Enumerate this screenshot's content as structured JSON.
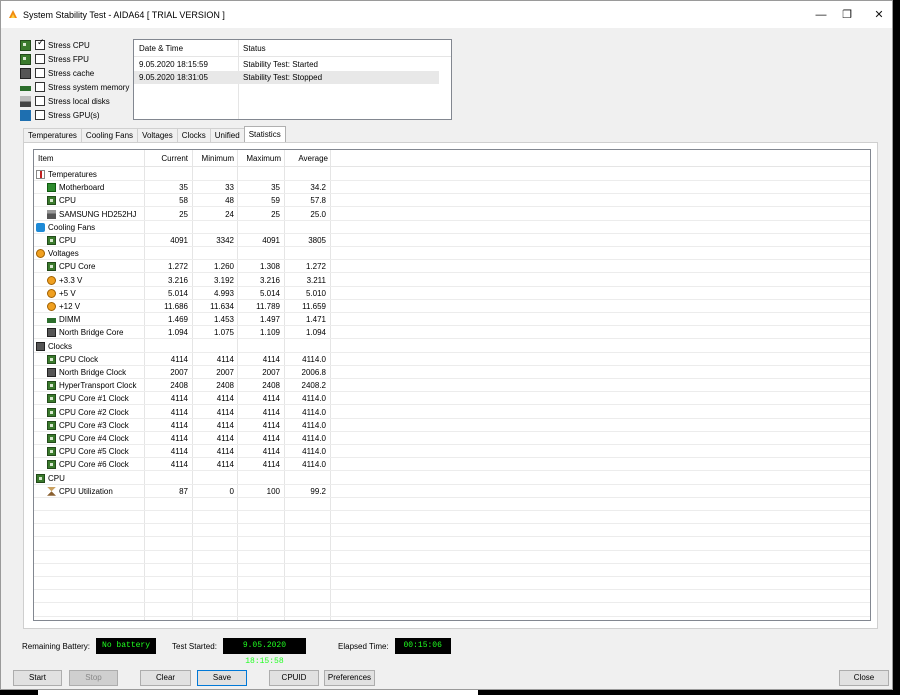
{
  "window": {
    "title": "System Stability Test - AIDA64  [ TRIAL VERSION ]",
    "minimize_glyph": "—",
    "maximize_glyph": "❐",
    "close_glyph": "✕"
  },
  "stress_options": [
    {
      "label": "Stress CPU",
      "checked": true,
      "icon": "cpu-icon"
    },
    {
      "label": "Stress FPU",
      "checked": false,
      "icon": "fpu-icon"
    },
    {
      "label": "Stress cache",
      "checked": false,
      "icon": "cache-icon"
    },
    {
      "label": "Stress system memory",
      "checked": false,
      "icon": "memory-icon"
    },
    {
      "label": "Stress local disks",
      "checked": false,
      "icon": "disk-icon"
    },
    {
      "label": "Stress GPU(s)",
      "checked": false,
      "icon": "gpu-icon"
    }
  ],
  "log": {
    "headers": {
      "datetime": "Date & Time",
      "status": "Status"
    },
    "rows": [
      {
        "datetime": "9.05.2020 18:15:59",
        "status": "Stability Test: Started"
      },
      {
        "datetime": "9.05.2020 18:31:05",
        "status": "Stability Test: Stopped"
      }
    ]
  },
  "tabs": [
    "Temperatures",
    "Cooling Fans",
    "Voltages",
    "Clocks",
    "Unified",
    "Statistics"
  ],
  "active_tab": "Statistics",
  "stats": {
    "headers": {
      "item": "Item",
      "current": "Current",
      "minimum": "Minimum",
      "maximum": "Maximum",
      "average": "Average"
    },
    "rows": [
      {
        "kind": "group",
        "item": "Temperatures",
        "icon": "thermometer-icon"
      },
      {
        "kind": "row",
        "item": "Motherboard",
        "icon": "motherboard-icon",
        "current": "35",
        "minimum": "33",
        "maximum": "35",
        "average": "34.2"
      },
      {
        "kind": "row",
        "item": "CPU",
        "icon": "cpu-icon",
        "current": "58",
        "minimum": "48",
        "maximum": "59",
        "average": "57.8"
      },
      {
        "kind": "row",
        "item": "SAMSUNG HD252HJ",
        "icon": "hdd-icon",
        "current": "25",
        "minimum": "24",
        "maximum": "25",
        "average": "25.0"
      },
      {
        "kind": "group",
        "item": "Cooling Fans",
        "icon": "fan-icon"
      },
      {
        "kind": "row",
        "item": "CPU",
        "icon": "cpu-icon",
        "current": "4091",
        "minimum": "3342",
        "maximum": "4091",
        "average": "3805"
      },
      {
        "kind": "group",
        "item": "Voltages",
        "icon": "voltage-icon"
      },
      {
        "kind": "row",
        "item": "CPU Core",
        "icon": "cpu-icon",
        "current": "1.272",
        "minimum": "1.260",
        "maximum": "1.308",
        "average": "1.272"
      },
      {
        "kind": "row",
        "item": "+3.3 V",
        "icon": "voltage-icon",
        "current": "3.216",
        "minimum": "3.192",
        "maximum": "3.216",
        "average": "3.211"
      },
      {
        "kind": "row",
        "item": "+5 V",
        "icon": "voltage-icon",
        "current": "5.014",
        "minimum": "4.993",
        "maximum": "5.014",
        "average": "5.010"
      },
      {
        "kind": "row",
        "item": "+12 V",
        "icon": "voltage-icon",
        "current": "11.686",
        "minimum": "11.634",
        "maximum": "11.789",
        "average": "11.659"
      },
      {
        "kind": "row",
        "item": "DIMM",
        "icon": "memory-icon",
        "current": "1.469",
        "minimum": "1.453",
        "maximum": "1.497",
        "average": "1.471"
      },
      {
        "kind": "row",
        "item": "North Bridge Core",
        "icon": "northbridge-icon",
        "current": "1.094",
        "minimum": "1.075",
        "maximum": "1.109",
        "average": "1.094"
      },
      {
        "kind": "group",
        "item": "Clocks",
        "icon": "clock-icon"
      },
      {
        "kind": "row",
        "item": "CPU Clock",
        "icon": "cpu-icon",
        "current": "4114",
        "minimum": "4114",
        "maximum": "4114",
        "average": "4114.0"
      },
      {
        "kind": "row",
        "item": "North Bridge Clock",
        "icon": "northbridge-icon",
        "current": "2007",
        "minimum": "2007",
        "maximum": "2007",
        "average": "2006.8"
      },
      {
        "kind": "row",
        "item": "HyperTransport Clock",
        "icon": "cpu-icon",
        "current": "2408",
        "minimum": "2408",
        "maximum": "2408",
        "average": "2408.2"
      },
      {
        "kind": "row",
        "item": "CPU Core #1 Clock",
        "icon": "cpu-icon",
        "current": "4114",
        "minimum": "4114",
        "maximum": "4114",
        "average": "4114.0"
      },
      {
        "kind": "row",
        "item": "CPU Core #2 Clock",
        "icon": "cpu-icon",
        "current": "4114",
        "minimum": "4114",
        "maximum": "4114",
        "average": "4114.0"
      },
      {
        "kind": "row",
        "item": "CPU Core #3 Clock",
        "icon": "cpu-icon",
        "current": "4114",
        "minimum": "4114",
        "maximum": "4114",
        "average": "4114.0"
      },
      {
        "kind": "row",
        "item": "CPU Core #4 Clock",
        "icon": "cpu-icon",
        "current": "4114",
        "minimum": "4114",
        "maximum": "4114",
        "average": "4114.0"
      },
      {
        "kind": "row",
        "item": "CPU Core #5 Clock",
        "icon": "cpu-icon",
        "current": "4114",
        "minimum": "4114",
        "maximum": "4114",
        "average": "4114.0"
      },
      {
        "kind": "row",
        "item": "CPU Core #6 Clock",
        "icon": "cpu-icon",
        "current": "4114",
        "minimum": "4114",
        "maximum": "4114",
        "average": "4114.0"
      },
      {
        "kind": "group",
        "item": "CPU",
        "icon": "cpu-icon"
      },
      {
        "kind": "row",
        "item": "CPU Utilization",
        "icon": "hourglass-icon",
        "current": "87",
        "minimum": "0",
        "maximum": "100",
        "average": "99.2"
      }
    ]
  },
  "status_bar": {
    "battery_label": "Remaining Battery:",
    "battery_value": "No battery",
    "started_label": "Test Started:",
    "started_value": "9.05.2020 18:15:58",
    "elapsed_label": "Elapsed Time:",
    "elapsed_value": "00:15:06"
  },
  "buttons": {
    "start": "Start",
    "stop": "Stop",
    "clear": "Clear",
    "save": "Save",
    "cpuid": "CPUID",
    "preferences": "Preferences",
    "close": "Close"
  },
  "colors": {
    "status_value_bg": "#000000",
    "status_value_text": "#20ff20",
    "focus_border": "#0078d7"
  }
}
